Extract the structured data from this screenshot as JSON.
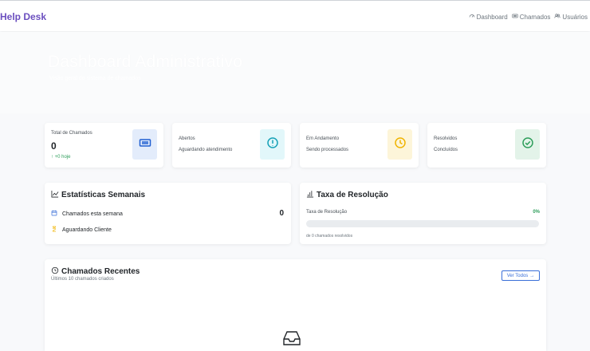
{
  "header": {
    "brand": "Help Desk",
    "nav": [
      {
        "label": "Dashboard",
        "icon": "speedometer-icon"
      },
      {
        "label": "Chamados",
        "icon": "ticket-icon"
      },
      {
        "label": "Usuários",
        "icon": "users-icon"
      }
    ]
  },
  "hero": {
    "title": "Dashboard Administrativo",
    "subtitle": "Visão geral do sistema de chamados"
  },
  "stats": [
    {
      "label": "Total de Chamados",
      "value": "0",
      "delta": "↑ +0 hoje",
      "icon": "ticket-icon",
      "icon_color": "#1f5fd1",
      "icon_bg": "#e3ecfb"
    },
    {
      "title": "Abertos",
      "subtitle": "Aguardando atendimento",
      "icon": "alert-circle-icon",
      "icon_color": "#17a2b8",
      "icon_bg": "#e2f7fa"
    },
    {
      "title": "Em Andamento",
      "subtitle": "Sendo processados",
      "icon": "clock-icon",
      "icon_color": "#f0b400",
      "icon_bg": "#fdf5d9"
    },
    {
      "title": "Resolvidos",
      "subtitle": "Concluídos",
      "icon": "check-circle-icon",
      "icon_color": "#2e9e5b",
      "icon_bg": "#e3f3e9"
    }
  ],
  "weekly": {
    "title": "Estatísticas Semanais",
    "rows": [
      {
        "label": "Chamados esta semana",
        "icon": "calendar-icon",
        "icon_color": "#3a6fd8"
      },
      {
        "label": "Aguardando Cliente",
        "icon": "hourglass-icon",
        "icon_color": "#f0b400"
      }
    ],
    "value": "0"
  },
  "resolution": {
    "title": "Taxa de Resolução",
    "label": "Taxa de Resolução",
    "percent_text": "0%",
    "progress_fraction": 0,
    "footer": "de 0 chamados resolvidos"
  },
  "recent": {
    "title": "Chamados Recentes",
    "subtitle": "Últimos 10 chamados criados",
    "button_label": "Ver Todos",
    "button_arrow": "→",
    "empty_icon": "inbox-icon"
  },
  "colors": {
    "brand": "#6b4fbf",
    "success": "#2e9e5b",
    "primary": "#3a6fd8"
  }
}
